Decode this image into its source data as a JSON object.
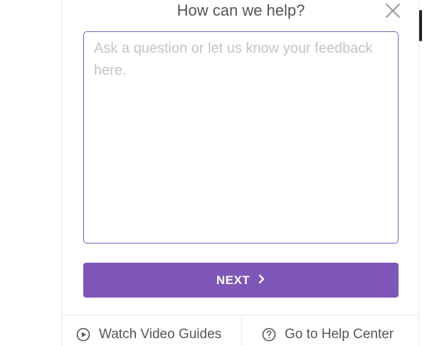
{
  "dialog": {
    "title": "How can we help?",
    "close_icon": "close-icon"
  },
  "feedback": {
    "value": "",
    "placeholder": "Ask a question or let us know your feedback here."
  },
  "next_button": {
    "label": "NEXT",
    "icon": "chevron-right-icon"
  },
  "footer": {
    "video_guides": {
      "label": "Watch Video Guides",
      "icon": "play-circle-icon"
    },
    "help_center": {
      "label": "Go to Help Center",
      "icon": "question-circle-icon"
    }
  },
  "colors": {
    "accent": "#7e56b8",
    "input_border": "#7a5cc0",
    "text": "#555555",
    "placeholder": "#c4c4c4"
  }
}
